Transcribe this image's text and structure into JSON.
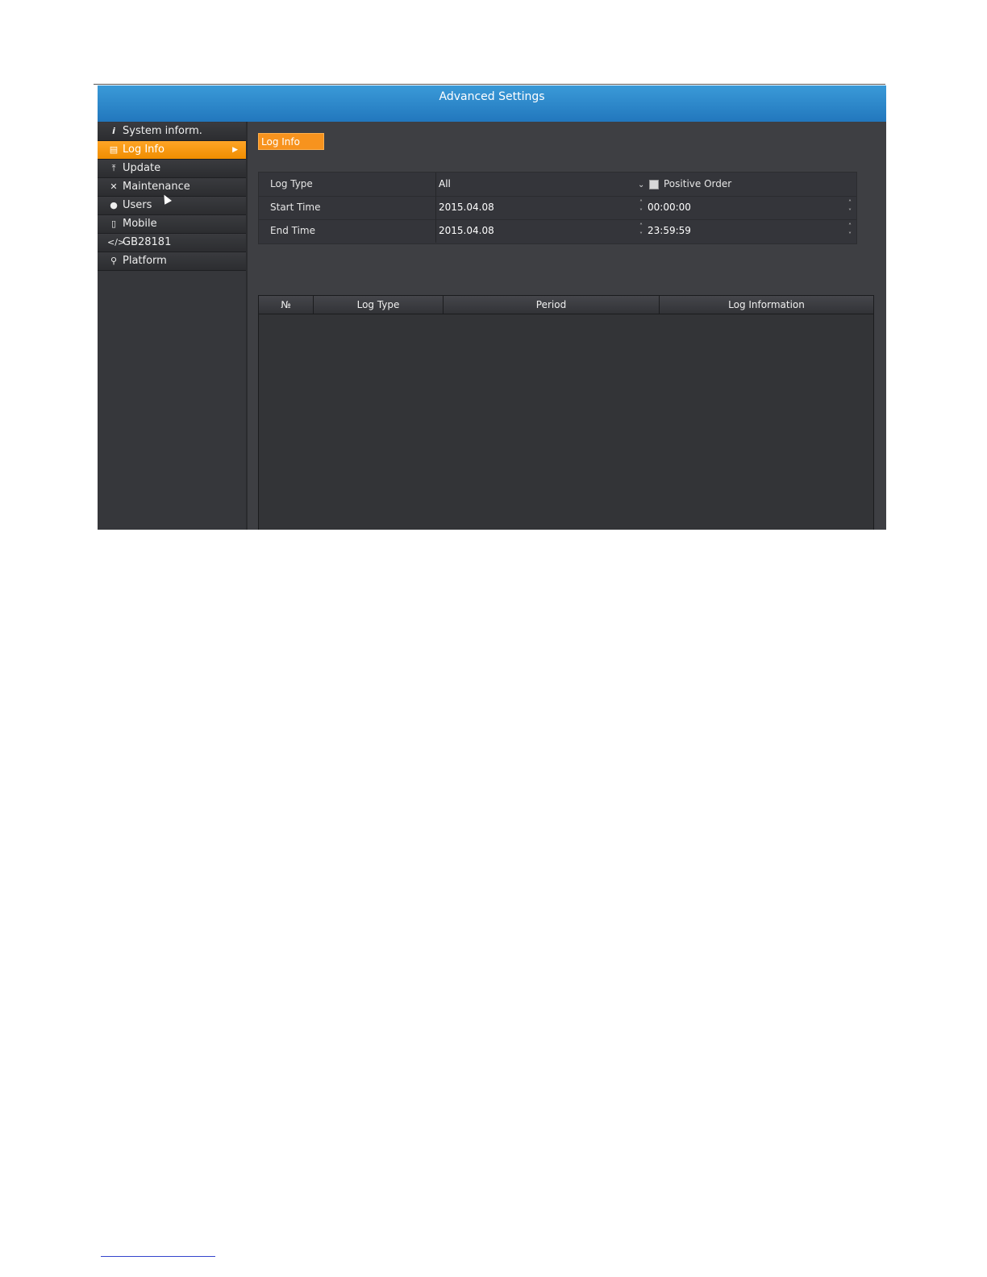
{
  "window": {
    "title": "Advanced Settings"
  },
  "sidebar": {
    "items": [
      {
        "label": "System inform.",
        "icon": "info-icon"
      },
      {
        "label": "Log Info",
        "icon": "log-icon",
        "active": true
      },
      {
        "label": "Update",
        "icon": "upload-icon"
      },
      {
        "label": "Maintenance",
        "icon": "tools-icon"
      },
      {
        "label": "Users",
        "icon": "user-icon"
      },
      {
        "label": "Mobile",
        "icon": "mobile-icon"
      },
      {
        "label": "GB28181",
        "icon": "code-icon"
      },
      {
        "label": "Platform",
        "icon": "link-icon"
      }
    ]
  },
  "content": {
    "tab_label": "Log Info",
    "form": {
      "log_type_label": "Log Type",
      "log_type_value": "All",
      "positive_order_label": "Positive Order",
      "positive_order_checked": false,
      "start_time_label": "Start Time",
      "start_date": "2015.04.08",
      "start_time": "00:00:00",
      "end_time_label": "End Time",
      "end_date": "2015.04.08",
      "end_time": "23:59:59"
    },
    "table": {
      "columns": [
        "№",
        "Log Type",
        "Period",
        "Log Information"
      ],
      "rows": []
    }
  },
  "colors": {
    "accent": "#f7931e",
    "titlebar": "#2a86c9",
    "panel": "#3e3f43"
  }
}
